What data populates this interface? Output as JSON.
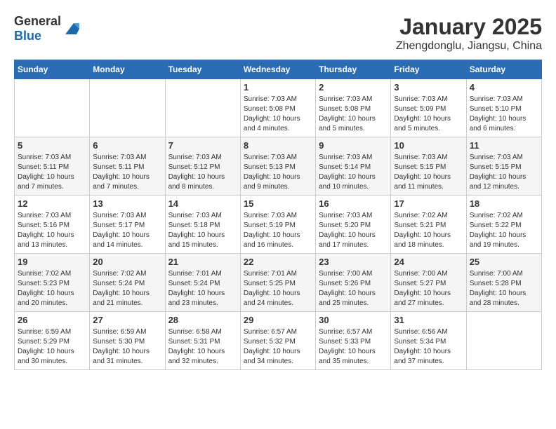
{
  "logo": {
    "general": "General",
    "blue": "Blue"
  },
  "title": "January 2025",
  "subtitle": "Zhengdonglu, Jiangsu, China",
  "weekdays": [
    "Sunday",
    "Monday",
    "Tuesday",
    "Wednesday",
    "Thursday",
    "Friday",
    "Saturday"
  ],
  "weeks": [
    [
      {
        "day": "",
        "info": ""
      },
      {
        "day": "",
        "info": ""
      },
      {
        "day": "",
        "info": ""
      },
      {
        "day": "1",
        "info": "Sunrise: 7:03 AM\nSunset: 5:08 PM\nDaylight: 10 hours\nand 4 minutes."
      },
      {
        "day": "2",
        "info": "Sunrise: 7:03 AM\nSunset: 5:08 PM\nDaylight: 10 hours\nand 5 minutes."
      },
      {
        "day": "3",
        "info": "Sunrise: 7:03 AM\nSunset: 5:09 PM\nDaylight: 10 hours\nand 5 minutes."
      },
      {
        "day": "4",
        "info": "Sunrise: 7:03 AM\nSunset: 5:10 PM\nDaylight: 10 hours\nand 6 minutes."
      }
    ],
    [
      {
        "day": "5",
        "info": "Sunrise: 7:03 AM\nSunset: 5:11 PM\nDaylight: 10 hours\nand 7 minutes."
      },
      {
        "day": "6",
        "info": "Sunrise: 7:03 AM\nSunset: 5:11 PM\nDaylight: 10 hours\nand 7 minutes."
      },
      {
        "day": "7",
        "info": "Sunrise: 7:03 AM\nSunset: 5:12 PM\nDaylight: 10 hours\nand 8 minutes."
      },
      {
        "day": "8",
        "info": "Sunrise: 7:03 AM\nSunset: 5:13 PM\nDaylight: 10 hours\nand 9 minutes."
      },
      {
        "day": "9",
        "info": "Sunrise: 7:03 AM\nSunset: 5:14 PM\nDaylight: 10 hours\nand 10 minutes."
      },
      {
        "day": "10",
        "info": "Sunrise: 7:03 AM\nSunset: 5:15 PM\nDaylight: 10 hours\nand 11 minutes."
      },
      {
        "day": "11",
        "info": "Sunrise: 7:03 AM\nSunset: 5:15 PM\nDaylight: 10 hours\nand 12 minutes."
      }
    ],
    [
      {
        "day": "12",
        "info": "Sunrise: 7:03 AM\nSunset: 5:16 PM\nDaylight: 10 hours\nand 13 minutes."
      },
      {
        "day": "13",
        "info": "Sunrise: 7:03 AM\nSunset: 5:17 PM\nDaylight: 10 hours\nand 14 minutes."
      },
      {
        "day": "14",
        "info": "Sunrise: 7:03 AM\nSunset: 5:18 PM\nDaylight: 10 hours\nand 15 minutes."
      },
      {
        "day": "15",
        "info": "Sunrise: 7:03 AM\nSunset: 5:19 PM\nDaylight: 10 hours\nand 16 minutes."
      },
      {
        "day": "16",
        "info": "Sunrise: 7:03 AM\nSunset: 5:20 PM\nDaylight: 10 hours\nand 17 minutes."
      },
      {
        "day": "17",
        "info": "Sunrise: 7:02 AM\nSunset: 5:21 PM\nDaylight: 10 hours\nand 18 minutes."
      },
      {
        "day": "18",
        "info": "Sunrise: 7:02 AM\nSunset: 5:22 PM\nDaylight: 10 hours\nand 19 minutes."
      }
    ],
    [
      {
        "day": "19",
        "info": "Sunrise: 7:02 AM\nSunset: 5:23 PM\nDaylight: 10 hours\nand 20 minutes."
      },
      {
        "day": "20",
        "info": "Sunrise: 7:02 AM\nSunset: 5:24 PM\nDaylight: 10 hours\nand 21 minutes."
      },
      {
        "day": "21",
        "info": "Sunrise: 7:01 AM\nSunset: 5:24 PM\nDaylight: 10 hours\nand 23 minutes."
      },
      {
        "day": "22",
        "info": "Sunrise: 7:01 AM\nSunset: 5:25 PM\nDaylight: 10 hours\nand 24 minutes."
      },
      {
        "day": "23",
        "info": "Sunrise: 7:00 AM\nSunset: 5:26 PM\nDaylight: 10 hours\nand 25 minutes."
      },
      {
        "day": "24",
        "info": "Sunrise: 7:00 AM\nSunset: 5:27 PM\nDaylight: 10 hours\nand 27 minutes."
      },
      {
        "day": "25",
        "info": "Sunrise: 7:00 AM\nSunset: 5:28 PM\nDaylight: 10 hours\nand 28 minutes."
      }
    ],
    [
      {
        "day": "26",
        "info": "Sunrise: 6:59 AM\nSunset: 5:29 PM\nDaylight: 10 hours\nand 30 minutes."
      },
      {
        "day": "27",
        "info": "Sunrise: 6:59 AM\nSunset: 5:30 PM\nDaylight: 10 hours\nand 31 minutes."
      },
      {
        "day": "28",
        "info": "Sunrise: 6:58 AM\nSunset: 5:31 PM\nDaylight: 10 hours\nand 32 minutes."
      },
      {
        "day": "29",
        "info": "Sunrise: 6:57 AM\nSunset: 5:32 PM\nDaylight: 10 hours\nand 34 minutes."
      },
      {
        "day": "30",
        "info": "Sunrise: 6:57 AM\nSunset: 5:33 PM\nDaylight: 10 hours\nand 35 minutes."
      },
      {
        "day": "31",
        "info": "Sunrise: 6:56 AM\nSunset: 5:34 PM\nDaylight: 10 hours\nand 37 minutes."
      },
      {
        "day": "",
        "info": ""
      }
    ]
  ]
}
